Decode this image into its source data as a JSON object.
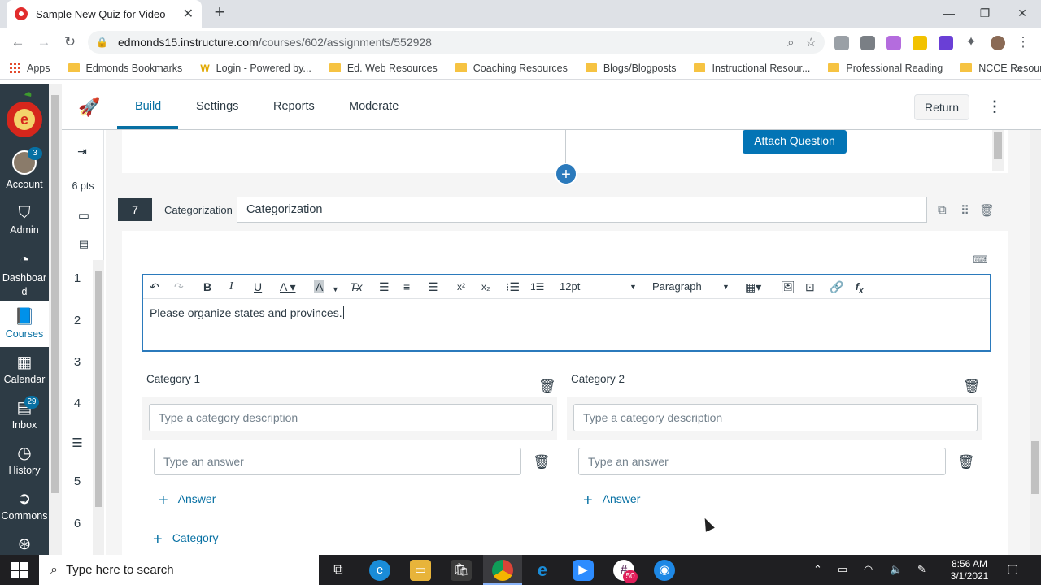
{
  "browser": {
    "tab_title": "Sample New Quiz for Video",
    "url_host": "edmonds15.instructure.com",
    "url_path": "/courses/602/assignments/552928",
    "bookmarks": [
      "Apps",
      "Edmonds Bookmarks",
      "Login - Powered by...",
      "Ed. Web Resources",
      "Coaching Resources",
      "Blogs/Blogposts",
      "Instructional Resour...",
      "Professional Reading",
      "NCCE Resources"
    ]
  },
  "global_nav": {
    "items": [
      {
        "label": "Account",
        "badge": "3"
      },
      {
        "label": "Admin"
      },
      {
        "label": "Dashboard"
      },
      {
        "label": "Courses"
      },
      {
        "label": "Calendar"
      },
      {
        "label": "Inbox",
        "badge": "29"
      },
      {
        "label": "History"
      },
      {
        "label": "Commons"
      }
    ]
  },
  "quiz_header": {
    "tabs": [
      "Build",
      "Settings",
      "Reports",
      "Moderate"
    ],
    "active_tab": "Build",
    "return_label": "Return"
  },
  "question_nav": {
    "points": "6 pts",
    "numbers": [
      "1",
      "2",
      "3",
      "4",
      "5",
      "6"
    ]
  },
  "previous_question": {
    "attach_label": "Attach Question"
  },
  "question": {
    "number": "7",
    "type_label": "Categorization",
    "title": "Categorization",
    "editor": {
      "font_size": "12pt",
      "block_format": "Paragraph",
      "body": "Please organize states and provinces."
    },
    "categories": [
      {
        "title": "Category 1",
        "description_placeholder": "Type a category description",
        "answer_placeholder": "Type an answer",
        "add_answer_label": "Answer"
      },
      {
        "title": "Category 2",
        "description_placeholder": "Type a category description",
        "answer_placeholder": "Type an answer",
        "add_answer_label": "Answer"
      }
    ],
    "add_category_label": "Category"
  },
  "taskbar": {
    "search_placeholder": "Type here to search",
    "time": "8:56 AM",
    "date": "3/1/2021",
    "slack_badge": "50"
  },
  "colors": {
    "canvas_nav": "#2d3b45",
    "accent": "#0770a3",
    "attach_button": "#0374b5",
    "editor_focus": "#2b7abc"
  }
}
